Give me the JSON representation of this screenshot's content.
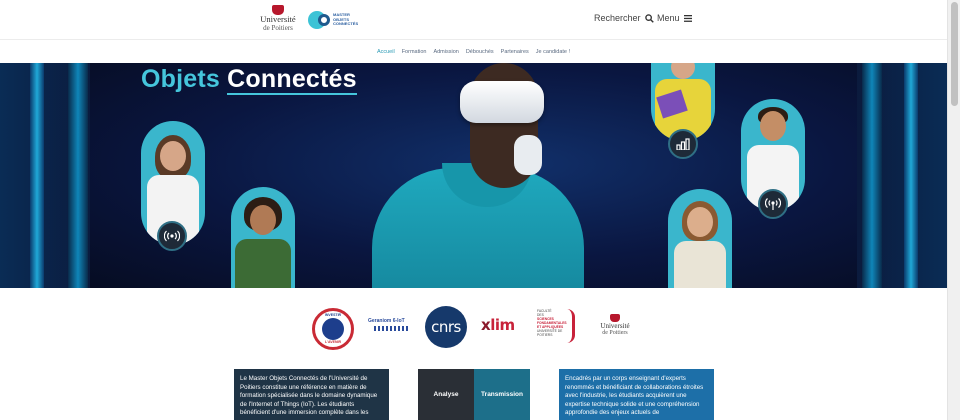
{
  "header": {
    "logo_univ_line1": "Université",
    "logo_univ_line2": "de Poitiers",
    "logo_master_text": "MASTER OBJETS CONNECTÉS",
    "search_label": "Rechercher",
    "menu_label": "Menu"
  },
  "nav": {
    "items": [
      {
        "label": "Accueil",
        "active": true
      },
      {
        "label": "Formation",
        "active": false
      },
      {
        "label": "Admission",
        "active": false
      },
      {
        "label": "Débouchés",
        "active": false
      },
      {
        "label": "Partenaires",
        "active": false
      },
      {
        "label": "Je candidate !",
        "active": false
      }
    ]
  },
  "hero": {
    "title_part1": "Objets",
    "title_part2": "Connectés",
    "badges": [
      "wireless-icon",
      "chart-icon",
      "broadcast-icon"
    ]
  },
  "partners": {
    "invest_top": "INVESTIR",
    "invest_bottom": "L'AVENIR",
    "geraniom": "Geraniom 6-IoT",
    "cnrs": "cnrs",
    "xlim_x": "x",
    "xlim_rest": "lim",
    "sciences_line1": "FACULTÉ",
    "sciences_line2": "DES",
    "sciences_line3": "SCIENCES",
    "sciences_line4": "FONDAMENTALES",
    "sciences_line5": "ET APPLIQUÉES",
    "sciences_line6": "UNIVERSITÉ DE POITIERS",
    "univ_line1": "Université",
    "univ_line2": "de Poitiers"
  },
  "cards": {
    "left_text": "Le Master Objets Connectés de l'Université de Poitiers constitue une référence en matière de formation spécialisée dans le domaine dynamique de l'Internet of Things (IoT). Les étudiants bénéficient d'une immersion complète dans les",
    "tab_a": "Analyse",
    "tab_b": "Transmission",
    "right_text": "Encadrés par un corps enseignant d'experts renommés et bénéficiant de collaborations étroites avec l'industrie, les étudiants acquièrent une expertise technique solide et une compréhension approfondie des enjeux actuels de"
  },
  "colors": {
    "accent": "#45c6dc",
    "nav_active": "#2a9ab5",
    "card_dark": "#1f3446",
    "card_blue": "#1d6fa8"
  }
}
